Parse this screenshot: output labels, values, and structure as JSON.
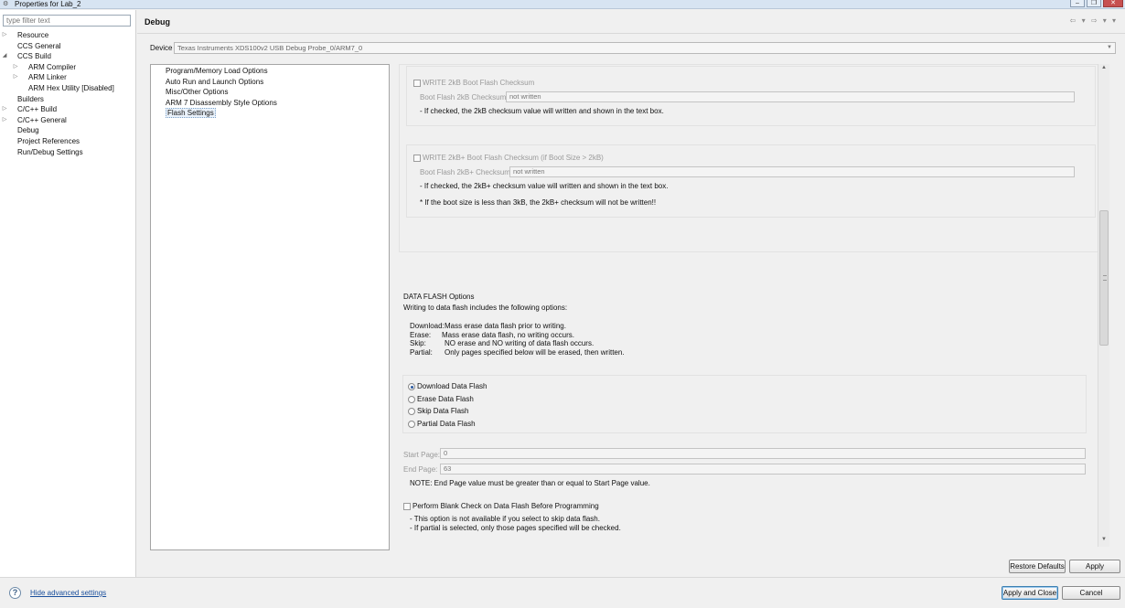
{
  "window": {
    "title": "Properties for Lab_2",
    "buttons": [
      "–",
      "❐",
      "✕"
    ]
  },
  "left": {
    "filter_placeholder": "type filter text",
    "tree": [
      {
        "label": "Resource",
        "level": 0,
        "arrow": "▷"
      },
      {
        "label": "CCS General",
        "level": 0,
        "arrow": ""
      },
      {
        "label": "CCS Build",
        "level": 0,
        "arrow": "◢"
      },
      {
        "label": "ARM Compiler",
        "level": 1,
        "arrow": "▷"
      },
      {
        "label": "ARM Linker",
        "level": 1,
        "arrow": "▷"
      },
      {
        "label": "ARM Hex Utility  [Disabled]",
        "level": 1,
        "arrow": ""
      },
      {
        "label": "Builders",
        "level": 0,
        "arrow": ""
      },
      {
        "label": "C/C++ Build",
        "level": 0,
        "arrow": "▷"
      },
      {
        "label": "C/C++ General",
        "level": 0,
        "arrow": "▷"
      },
      {
        "label": "Debug",
        "level": 0,
        "arrow": "",
        "selected": true
      },
      {
        "label": "Project References",
        "level": 0,
        "arrow": ""
      },
      {
        "label": "Run/Debug Settings",
        "level": 0,
        "arrow": ""
      }
    ]
  },
  "header": {
    "title": "Debug",
    "nav": "⇦ ▾ ⇨ ▾ ▾"
  },
  "device": {
    "label": "Device",
    "value": "Texas Instruments XDS100v2 USB Debug Probe_0/ARM7_0"
  },
  "categories": [
    "Program/Memory Load Options",
    "Auto Run and Launch Options",
    "Misc/Other Options",
    "ARM 7 Disassembly Style Options",
    "Flash Settings"
  ],
  "flash": {
    "write2k_label": "WRITE 2kB Boot Flash Checksum",
    "cs2k_label": "Boot Flash 2kB Checksum:",
    "cs2k_value": "not written",
    "cs2k_note": "- If checked, the 2kB checksum value will written and shown in the text box.",
    "write2kplus_label": "WRITE 2kB+ Boot Flash Checksum (if Boot Size > 2kB)",
    "cs2kplus_label": "Boot Flash 2kB+ Checksum:",
    "cs2kplus_value": "not written",
    "cs2kplus_note": "- If checked, the 2kB+ checksum value will written and shown in the text box.",
    "cs2kplus_note2": "* If the boot size is less than 3kB, the 2kB+ checksum will not be written!!",
    "data_flash_title": "DATA FLASH Options",
    "data_flash_intro": "Writing to data flash includes the following options:",
    "desc": [
      {
        "k": "Download:",
        "v": "Mass erase data flash prior to writing."
      },
      {
        "k": "Erase:",
        "v": "Mass erase data flash, no writing occurs."
      },
      {
        "k": "Skip:",
        "v": "NO erase and NO writing of data flash occurs."
      },
      {
        "k": "Partial:",
        "v": "Only pages specified below will be erased, then written."
      }
    ],
    "radios": [
      {
        "label": "Download Data Flash",
        "checked": true
      },
      {
        "label": "Erase Data Flash",
        "checked": false
      },
      {
        "label": "Skip Data Flash",
        "checked": false
      },
      {
        "label": "Partial Data Flash",
        "checked": false
      }
    ],
    "start_page_label": "Start Page:",
    "start_page_value": "0",
    "end_page_label": "End Page:",
    "end_page_value": "63",
    "page_note": "NOTE: End Page value must be greater than or equal to Start Page value.",
    "blank_check_label": "Perform Blank Check on Data Flash Before Programming",
    "blank_note1": "- This option is not available if you select to skip data flash.",
    "blank_note2": "- If partial is selected, only those pages specified will be checked."
  },
  "buttons": {
    "restore": "Restore Defaults",
    "apply": "Apply",
    "apply_close": "Apply and Close",
    "cancel": "Cancel"
  },
  "footer": {
    "help": "?",
    "hide_advanced": "Hide advanced settings"
  }
}
